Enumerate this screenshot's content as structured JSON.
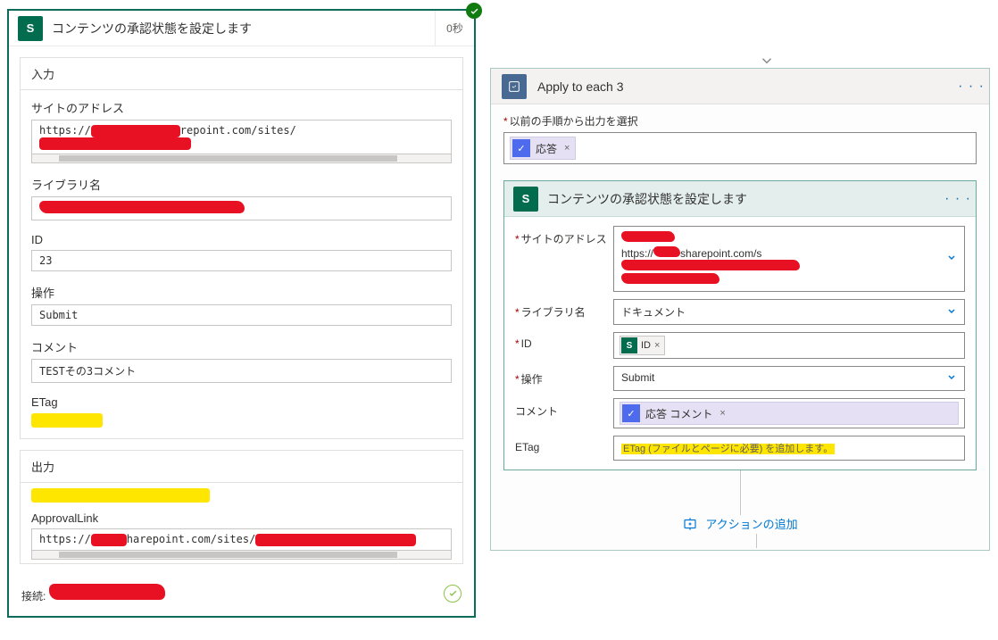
{
  "left": {
    "header_title": "コンテンツの承認状態を設定します",
    "header_time": "0秒",
    "input_section": "入力",
    "site_label": "サイトのアドレス",
    "site_prefix": "https://",
    "site_mid": "repoint.com/sites/",
    "lib_label": "ライブラリ名",
    "lib_value_prefix": "",
    "id_label": "ID",
    "id_value": "23",
    "op_label": "操作",
    "op_value": "Submit",
    "comment_label": "コメント",
    "comment_value": "TESTその3コメント",
    "etag_label": "ETag",
    "output_section": "出力",
    "approval_label": "ApprovalLink",
    "approval_prefix": "https://",
    "approval_mid": "harepoint.com/sites/",
    "footer_left": "接続:"
  },
  "right": {
    "outerTitle": "Apply to each 3",
    "prevOutputLabel": "以前の手順から出力を選択",
    "token1": "応答",
    "innerTitle": "コンテンツの承認状態を設定します",
    "siteLabel": "サイトのアドレス",
    "siteMid": "sharepoint.com/s",
    "sitePrefix": "https://",
    "libLabel": "ライブラリ名",
    "libValue": "ドキュメント",
    "idLabel": "ID",
    "idToken": "ID",
    "opLabel": "操作",
    "opValue": "Submit",
    "commentLabel": "コメント",
    "commentToken": "応答 コメント",
    "etagLabel": "ETag",
    "etagHint": "ETag (ファイルとページに必要) を追加します。",
    "addAction": "アクションの追加"
  }
}
